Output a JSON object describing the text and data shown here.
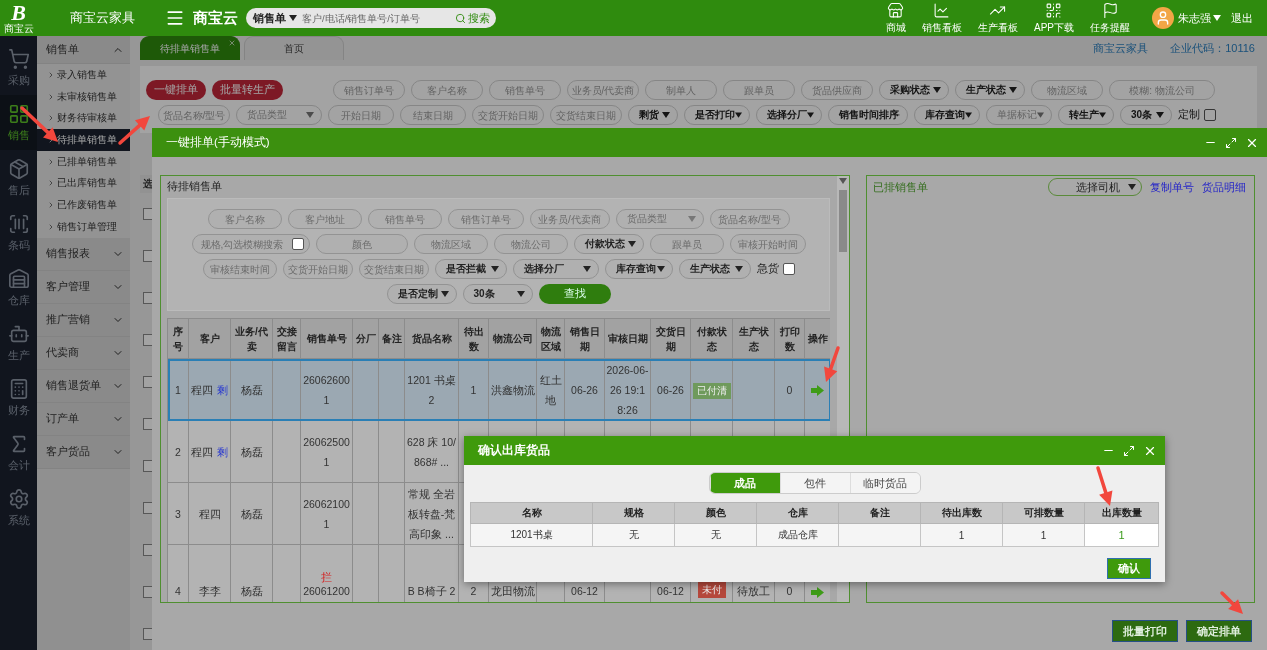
{
  "topbar": {
    "logo": {
      "letter": "B",
      "caption": "商宝云"
    },
    "brand": "商宝云家具",
    "product_logo": "商宝云",
    "search": {
      "scope": "销售单",
      "placeholder": "客户/电话/销售单号/订单号",
      "button": "搜索"
    },
    "shortcuts": [
      {
        "kind": "store",
        "label": "商城"
      },
      {
        "kind": "board",
        "label": "销售看板"
      },
      {
        "kind": "trend",
        "label": "生产看板"
      },
      {
        "kind": "qr",
        "label": "APP下载"
      },
      {
        "kind": "flag",
        "label": "任务提醒"
      }
    ],
    "user": "朱志强",
    "logout": "退出"
  },
  "icon_rail": [
    {
      "kind": "cart",
      "label": "采购",
      "selected": false
    },
    {
      "kind": "grid",
      "label": "销售",
      "selected": true
    },
    {
      "kind": "boxes",
      "label": "售后",
      "selected": false
    },
    {
      "kind": "barcode",
      "label": "条码",
      "selected": false
    },
    {
      "kind": "warehouse",
      "label": "仓库",
      "selected": false
    },
    {
      "kind": "robot",
      "label": "生产",
      "selected": false
    },
    {
      "kind": "calculator",
      "label": "财务",
      "selected": false
    },
    {
      "kind": "ledger",
      "label": "会计",
      "selected": false
    },
    {
      "kind": "gear",
      "label": "系统",
      "selected": false
    }
  ],
  "sidebar": {
    "groups": [
      {
        "label": "销售单",
        "expanded": true,
        "children": [
          {
            "label": "录入销售单",
            "selected": false
          },
          {
            "label": "未审核销售单",
            "selected": false
          },
          {
            "label": "财务待审核单",
            "selected": false
          },
          {
            "label": "待排单销售单",
            "selected": true
          },
          {
            "label": "已排单销售单",
            "selected": false
          },
          {
            "label": "已出库销售单",
            "selected": false
          },
          {
            "label": "已作废销售单",
            "selected": false
          },
          {
            "label": "销售订单管理",
            "selected": false
          }
        ]
      },
      {
        "label": "销售报表",
        "expanded": false
      },
      {
        "label": "客户管理",
        "expanded": false
      },
      {
        "label": "推广营销",
        "expanded": false
      },
      {
        "label": "代卖商",
        "expanded": false
      },
      {
        "label": "销售退货单",
        "expanded": false
      },
      {
        "label": "订产单",
        "expanded": false
      },
      {
        "label": "客户货品",
        "expanded": false
      }
    ]
  },
  "tabs": [
    {
      "label": "待排单销售单",
      "selected": true,
      "closable": true
    },
    {
      "label": "首页",
      "selected": false,
      "closable": false
    }
  ],
  "company": {
    "name": "商宝云家具",
    "code": "企业代码：10116"
  },
  "toolbar": {
    "actions": [
      "一键排单",
      "批量转生产"
    ],
    "first_line": [
      {
        "kind": "input",
        "placeholder": "销售订单号"
      },
      {
        "kind": "input",
        "placeholder": "客户名称"
      },
      {
        "kind": "input",
        "placeholder": "销售单号"
      },
      {
        "kind": "input",
        "placeholder": "业务员/代卖商"
      },
      {
        "kind": "input",
        "placeholder": "制单人"
      },
      {
        "kind": "input",
        "placeholder": "跟单员"
      },
      {
        "kind": "input",
        "placeholder": "货品供应商"
      },
      {
        "kind": "select",
        "label": "采购状态"
      },
      {
        "kind": "select",
        "label": "生产状态"
      },
      {
        "kind": "input",
        "placeholder": "物流区域"
      },
      {
        "kind": "input",
        "placeholder": "模糊: 物流公司"
      }
    ],
    "second_line": [
      {
        "kind": "input",
        "placeholder": "货品名称/型号"
      },
      {
        "kind": "select",
        "placeholder": "货品类型"
      },
      {
        "kind": "input",
        "placeholder": "开始日期"
      },
      {
        "kind": "input",
        "placeholder": "结束日期"
      },
      {
        "kind": "input",
        "placeholder": "交货开始日期"
      },
      {
        "kind": "input",
        "placeholder": "交货结束日期"
      },
      {
        "kind": "select",
        "label": "剩货"
      },
      {
        "kind": "select",
        "label": "是否打印"
      },
      {
        "kind": "select",
        "label": "选择分厂"
      },
      {
        "kind": "select",
        "label": "销售时间排序"
      },
      {
        "kind": "select",
        "label": "库存查询"
      },
      {
        "kind": "select",
        "placeholder": "单据标记"
      },
      {
        "kind": "select",
        "label": "转生产"
      },
      {
        "kind": "select",
        "label": "30条"
      },
      {
        "kind": "checkbox",
        "label": "定制",
        "checked": false
      }
    ]
  },
  "base_table": {
    "columns": [
      "选"
    ],
    "rows": [
      {
        "checked": false
      },
      {
        "checked": false
      },
      {
        "checked": false
      },
      {
        "checked": false
      },
      {
        "checked": false
      },
      {
        "checked": false
      },
      {
        "checked": false
      },
      {
        "checked": false
      },
      {
        "checked": false
      },
      {
        "checked": false
      },
      {
        "checked": false
      }
    ]
  },
  "modal": {
    "title": "一键排单(手动模式)",
    "pending": {
      "title": "待排销售单",
      "filters": [
        [
          {
            "kind": "input",
            "placeholder": "客户名称"
          },
          {
            "kind": "input",
            "placeholder": "客户地址"
          },
          {
            "kind": "input",
            "placeholder": "销售单号"
          },
          {
            "kind": "input",
            "placeholder": "销售订单号"
          },
          {
            "kind": "input",
            "placeholder": "业务员/代卖商"
          },
          {
            "kind": "select",
            "placeholder": "货品类型"
          },
          {
            "kind": "input",
            "placeholder": "货品名称/型号"
          }
        ],
        [
          {
            "kind": "fuzzy",
            "placeholder": "规格,勾选模糊搜索",
            "checked": false
          },
          {
            "kind": "input",
            "placeholder": "颜色"
          },
          {
            "kind": "input",
            "placeholder": "物流区域"
          },
          {
            "kind": "input",
            "placeholder": "物流公司"
          },
          {
            "kind": "select",
            "label": "付款状态"
          },
          {
            "kind": "input",
            "placeholder": "跟单员"
          },
          {
            "kind": "input",
            "placeholder": "审核开始时间"
          }
        ],
        [
          {
            "kind": "input",
            "placeholder": "审核结束时间"
          },
          {
            "kind": "input",
            "placeholder": "交货开始日期"
          },
          {
            "kind": "input",
            "placeholder": "交货结束日期"
          },
          {
            "kind": "select",
            "label": "是否拦截"
          },
          {
            "kind": "select",
            "label": "选择分厂"
          },
          {
            "kind": "select",
            "label": "库存查询"
          },
          {
            "kind": "select",
            "label": "生产状态"
          },
          {
            "kind": "checkbox",
            "label": "急货",
            "checked": false
          }
        ],
        [
          {
            "kind": "select",
            "label": "是否定制"
          },
          {
            "kind": "select",
            "label": "30条"
          },
          {
            "kind": "button",
            "label": "查找"
          }
        ]
      ],
      "table": {
        "columns": [
          "序号",
          "客户",
          "业务/代卖",
          "交接留言",
          "销售单号",
          "分厂",
          "备注",
          "货品名称",
          "待出数",
          "物流公司",
          "物流区域",
          "销售日期",
          "审核日期",
          "交货日期",
          "付款状态",
          "生产状态",
          "打印数",
          "操作"
        ],
        "rows": [
          {
            "selected": true,
            "seq": "1",
            "customer": "程四",
            "customer_tag": "剩",
            "salesperson": "杨磊",
            "order_no": "260626001",
            "product": "1201 书桌 2",
            "pending": "1",
            "logistics": "洪鑫物流",
            "area": "红土地",
            "sale_date": "06-26",
            "audit_date": "2026-06-26 19:18:26",
            "delivery_date": "06-26",
            "payment": {
              "text": "已付清",
              "color": "#6f9a5c"
            },
            "prints": "0",
            "dispatch_arrow": true
          },
          {
            "selected": false,
            "seq": "2",
            "customer": "程四",
            "customer_tag": "剩",
            "salesperson": "杨磊",
            "order_no": "260625001",
            "product": "628 床 10/868# ..."
          },
          {
            "selected": false,
            "seq": "3",
            "customer": "程四",
            "salesperson": "杨磊",
            "order_no": "260621001",
            "product": "常规 全岩板转盘-梵高印象 ..."
          },
          {
            "selected": false,
            "seq": "4",
            "customer": "李李",
            "salesperson": "杨磊",
            "order_tag": "拦",
            "order_no": "26061200",
            "product": "B B椅子 2",
            "pending": "2",
            "logistics": "龙田物流",
            "sale_date": "06-12",
            "delivery_date": "06-12",
            "payment": {
              "text": "未付",
              "color": "#b5483c"
            },
            "production": "待放工",
            "prints": "0",
            "dispatch_arrow": true
          }
        ]
      }
    },
    "scheduled": {
      "title": "已排销售单",
      "driver_select": "选择司机",
      "links": [
        "复制单号",
        "货品明细"
      ]
    },
    "buttons": [
      "批量打印",
      "确定排单"
    ]
  },
  "dialog": {
    "title": "确认出库货品",
    "tabs": [
      {
        "label": "成品",
        "selected": true
      },
      {
        "label": "包件",
        "selected": false
      },
      {
        "label": "临时货品",
        "selected": false
      }
    ],
    "columns": [
      "名称",
      "规格",
      "颜色",
      "仓库",
      "备注",
      "待出库数",
      "可排数量",
      "出库数量"
    ],
    "rows": [
      {
        "name": "1201书桌",
        "spec": "无",
        "finish": "无",
        "warehouse": "成品仓库",
        "pending": "1",
        "available": "1",
        "quantity": "1"
      }
    ],
    "confirm": "确认"
  }
}
